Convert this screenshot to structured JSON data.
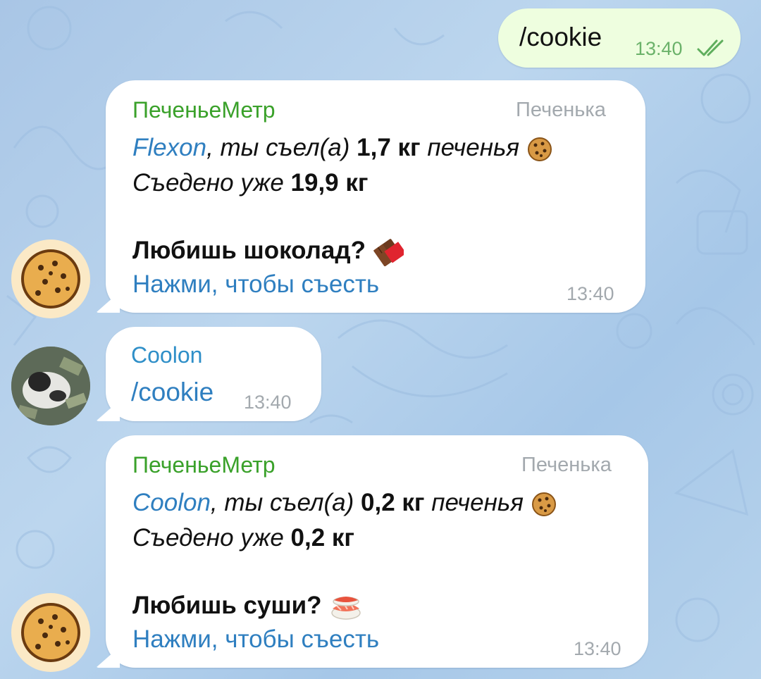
{
  "colors": {
    "background": "#b1cde9",
    "incoming_bubble": "#ffffff",
    "outgoing_bubble": "#eefedf",
    "bot_name": "#3aa12a",
    "user_name": "#2f8fc8",
    "link": "#2f7fc0",
    "meta": "#a3a9ae",
    "read_checks": "#5fae5d"
  },
  "messages": {
    "m1": {
      "text": "/cookie",
      "time": "13:40",
      "status_icon": "double-check-icon"
    },
    "m2": {
      "sender": "ПеченьеМетр",
      "tag": "Печенька",
      "mention": "Flexon",
      "l1_text": ", ты съел(а) ",
      "l1_amount": "1,7 кг",
      "l1_tail": " печенья",
      "l1_emoji": "cookie-emoji",
      "l2_text": "Съедено уже ",
      "l2_amount": "19,9 кг",
      "question": "Любишь шоколад?",
      "question_emoji": "chocolate-bar-emoji",
      "link": "Нажми, чтобы съесть",
      "time": "13:40",
      "avatar": "cookie-avatar"
    },
    "m3": {
      "sender": "Coolon",
      "text": "/cookie",
      "time": "13:40",
      "avatar": "cat-photo-avatar"
    },
    "m4": {
      "sender": "ПеченьеМетр",
      "tag": "Печенька",
      "mention": "Coolon",
      "l1_text": ", ты съел(а) ",
      "l1_amount": "0,2 кг",
      "l1_tail": " печенья",
      "l1_emoji": "cookie-emoji",
      "l2_text": "Съедено уже ",
      "l2_amount": "0,2 кг",
      "question": "Любишь суши?",
      "question_emoji": "sushi-emoji",
      "link": "Нажми, чтобы съесть",
      "time": "13:40",
      "avatar": "cookie-avatar"
    }
  }
}
